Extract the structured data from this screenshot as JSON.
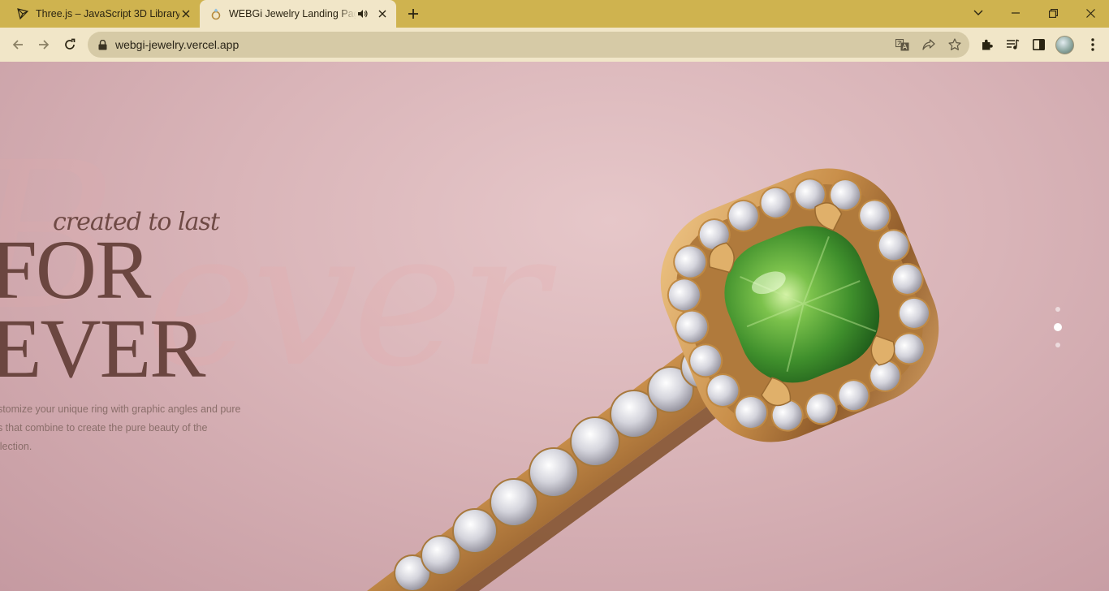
{
  "browser": {
    "tabs": [
      {
        "title": "Three.js – JavaScript 3D Library",
        "favicon": "threejs-icon",
        "active": false
      },
      {
        "title": "WEBGi Jewelry Landing Page",
        "favicon": "ring-favicon-icon",
        "active": true
      }
    ],
    "url": "webgi-jewelry.vercel.app",
    "colors": {
      "tabstrip": "#cfb34f",
      "toolbar": "#f1e6c8",
      "omnibox": "#d6caa6"
    }
  },
  "hero": {
    "tagline": "created to last",
    "headline_1": "FOR",
    "headline_2": "EVER",
    "description": [
      "ustomize your unique ring with graphic angles and pure",
      "es that combine to create the pure beauty of the",
      "ollection."
    ],
    "colors": {
      "headline": "#6b4640",
      "gem": "#5aa33a",
      "gold": "#d6a35c"
    }
  },
  "pagination": {
    "count": 3,
    "active_index": 1
  }
}
